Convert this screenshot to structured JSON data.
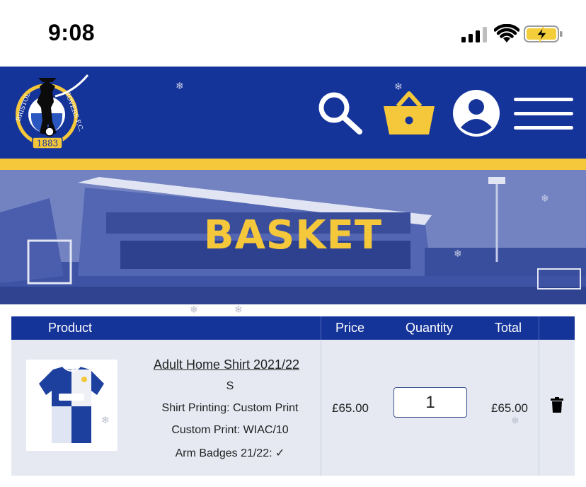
{
  "status_bar": {
    "time": "9:08"
  },
  "header": {
    "logo_text_top": "BRISTOL",
    "logo_text_right": "ROVERS F.C.",
    "logo_year": "1883",
    "icons": [
      "search-icon",
      "basket-icon",
      "account-icon",
      "menu-icon"
    ],
    "colors": {
      "brand_blue": "#15349a",
      "brand_yellow": "#f5c73a"
    }
  },
  "hero": {
    "title": "BASKET"
  },
  "table": {
    "columns": [
      "Product",
      "Price",
      "Quantity",
      "Total"
    ],
    "rows": [
      {
        "name": "Adult Home Shirt 2021/22",
        "size": "S",
        "printing": "Shirt Printing: Custom Print",
        "custom_print": "Custom Print: WIAC/10",
        "arm_badges": "Arm Badges 21/22: ✓",
        "price": "£65.00",
        "quantity": "1",
        "total": "£65.00"
      }
    ]
  }
}
